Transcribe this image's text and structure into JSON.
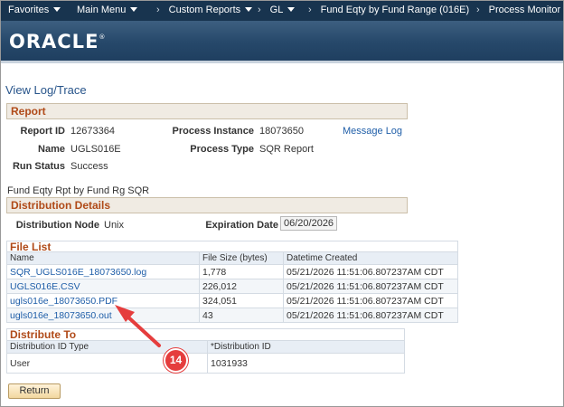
{
  "nav": {
    "favorites": "Favorites",
    "main_menu": "Main Menu",
    "breadcrumbs": [
      "Custom Reports",
      "GL",
      "Fund Eqty by Fund Range (016E)",
      "Process Monitor"
    ]
  },
  "brand": {
    "logo": "ORACLE",
    "reg": "®"
  },
  "page_title": "View Log/Trace",
  "report_section": {
    "header": "Report",
    "report_id_label": "Report ID",
    "report_id": "12673364",
    "process_instance_label": "Process Instance",
    "process_instance": "18073650",
    "message_log": "Message Log",
    "name_label": "Name",
    "name": "UGLS016E",
    "process_type_label": "Process Type",
    "process_type": "SQR Report",
    "run_status_label": "Run Status",
    "run_status": "Success",
    "description": "Fund Eqty Rpt by Fund Rg SQR"
  },
  "distribution_details": {
    "header": "Distribution Details",
    "node_label": "Distribution Node",
    "node": "Unix",
    "expiration_label": "Expiration Date",
    "expiration": "06/20/2026"
  },
  "file_list": {
    "header": "File List",
    "columns": [
      "Name",
      "File Size (bytes)",
      "Datetime Created"
    ],
    "rows": [
      {
        "name": "SQR_UGLS016E_18073650.log",
        "size": "1,778",
        "created": "05/21/2026 11:51:06.807237AM CDT"
      },
      {
        "name": "UGLS016E.CSV",
        "size": "226,012",
        "created": "05/21/2026 11:51:06.807237AM CDT"
      },
      {
        "name": "ugls016e_18073650.PDF",
        "size": "324,051",
        "created": "05/21/2026 11:51:06.807237AM CDT"
      },
      {
        "name": "ugls016e_18073650.out",
        "size": "43",
        "created": "05/21/2026 11:51:06.807237AM CDT"
      }
    ]
  },
  "distribute_to": {
    "header": "Distribute To",
    "columns": [
      "Distribution ID Type",
      "*Distribution ID"
    ],
    "rows": [
      {
        "type": "User",
        "id": "1031933"
      }
    ]
  },
  "return_button": "Return",
  "callout": {
    "number": "14",
    "color": "#e53d3d"
  },
  "colors": {
    "nav_bg": "#18344f",
    "section_text": "#b04a18",
    "link": "#1f5ea8"
  }
}
